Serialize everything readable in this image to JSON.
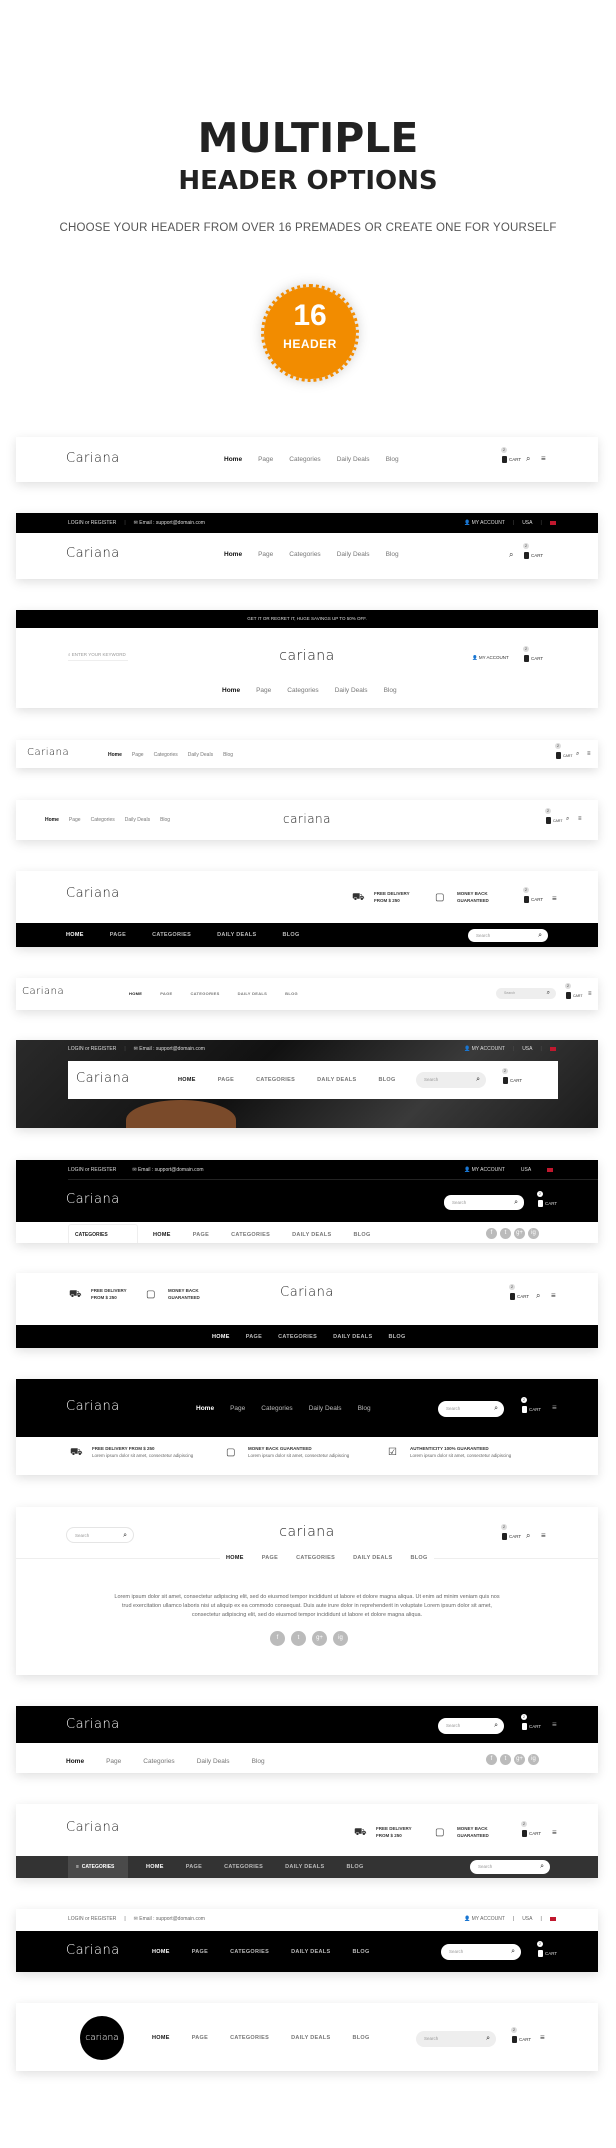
{
  "hero": {
    "title": "MULTIPLE",
    "subtitle": "HEADER OPTIONS",
    "description": "CHOOSE YOUR HEADER FROM OVER 16 PREMADES OR CREATE ONE FOR YOURSELF",
    "badge_number": "16",
    "badge_label": "HEADER",
    "badge_color": "#f28c00"
  },
  "brand": {
    "logo": "Cariana",
    "logo_lower": "cariana"
  },
  "nav": {
    "items": [
      "Home",
      "Page",
      "Categories",
      "Daily Deals",
      "Blog"
    ]
  },
  "topbar": {
    "login": "LOGIN or REGISTER",
    "email": "Email : support@domain.com",
    "account": "MY ACCOUNT",
    "region": "USA",
    "promo": "GET IT OR REGRET IT, HUGE SAVINGS UP TO 50% OFF."
  },
  "cart": {
    "label": "CART",
    "count": "2"
  },
  "search": {
    "placeholder": "Search",
    "keyword_placeholder": "ENTER YOUR KEYWORD"
  },
  "categories_label": "CATEGORIES",
  "features": {
    "delivery_line1": "FREE DELIVERY",
    "delivery_line2": "FROM $ 250",
    "money_line1": "MONEY BACK",
    "money_line2": "GUARANTEED",
    "full": [
      {
        "title": "FREE DELIVERY FROM $ 250",
        "text": "Lorem ipsum dolor sit amet, consectetur adipiscing"
      },
      {
        "title": "MONEY BACK GUARANTEED",
        "text": "Lorem ipsum dolor sit amet, consectetur adipiscing"
      },
      {
        "title": "AUTHENTICITY 100% GUARANTEED",
        "text": "Lorem ipsum dolor sit amet, consectetur adipiscing"
      }
    ]
  },
  "paragraph": "Lorem ipsum dolor sit amet, consectetur adipiscing elit, sed do eiusmod tempor incididunt ut labore et dolore magna aliqua. Ut enim ad minim veniam quis nos trud exercitation ullamco laboris nisi ut aliquip ex ea commodo consequat. Duis aute irure dolor in reprehenderit in voluptate Lorem ipsum dolor sit amet, consectetur adipiscing elit, sed do eiusmod tempor incididunt ut labore et dolore magna aliqua.",
  "social": [
    "f",
    "t",
    "g+",
    "ig"
  ]
}
